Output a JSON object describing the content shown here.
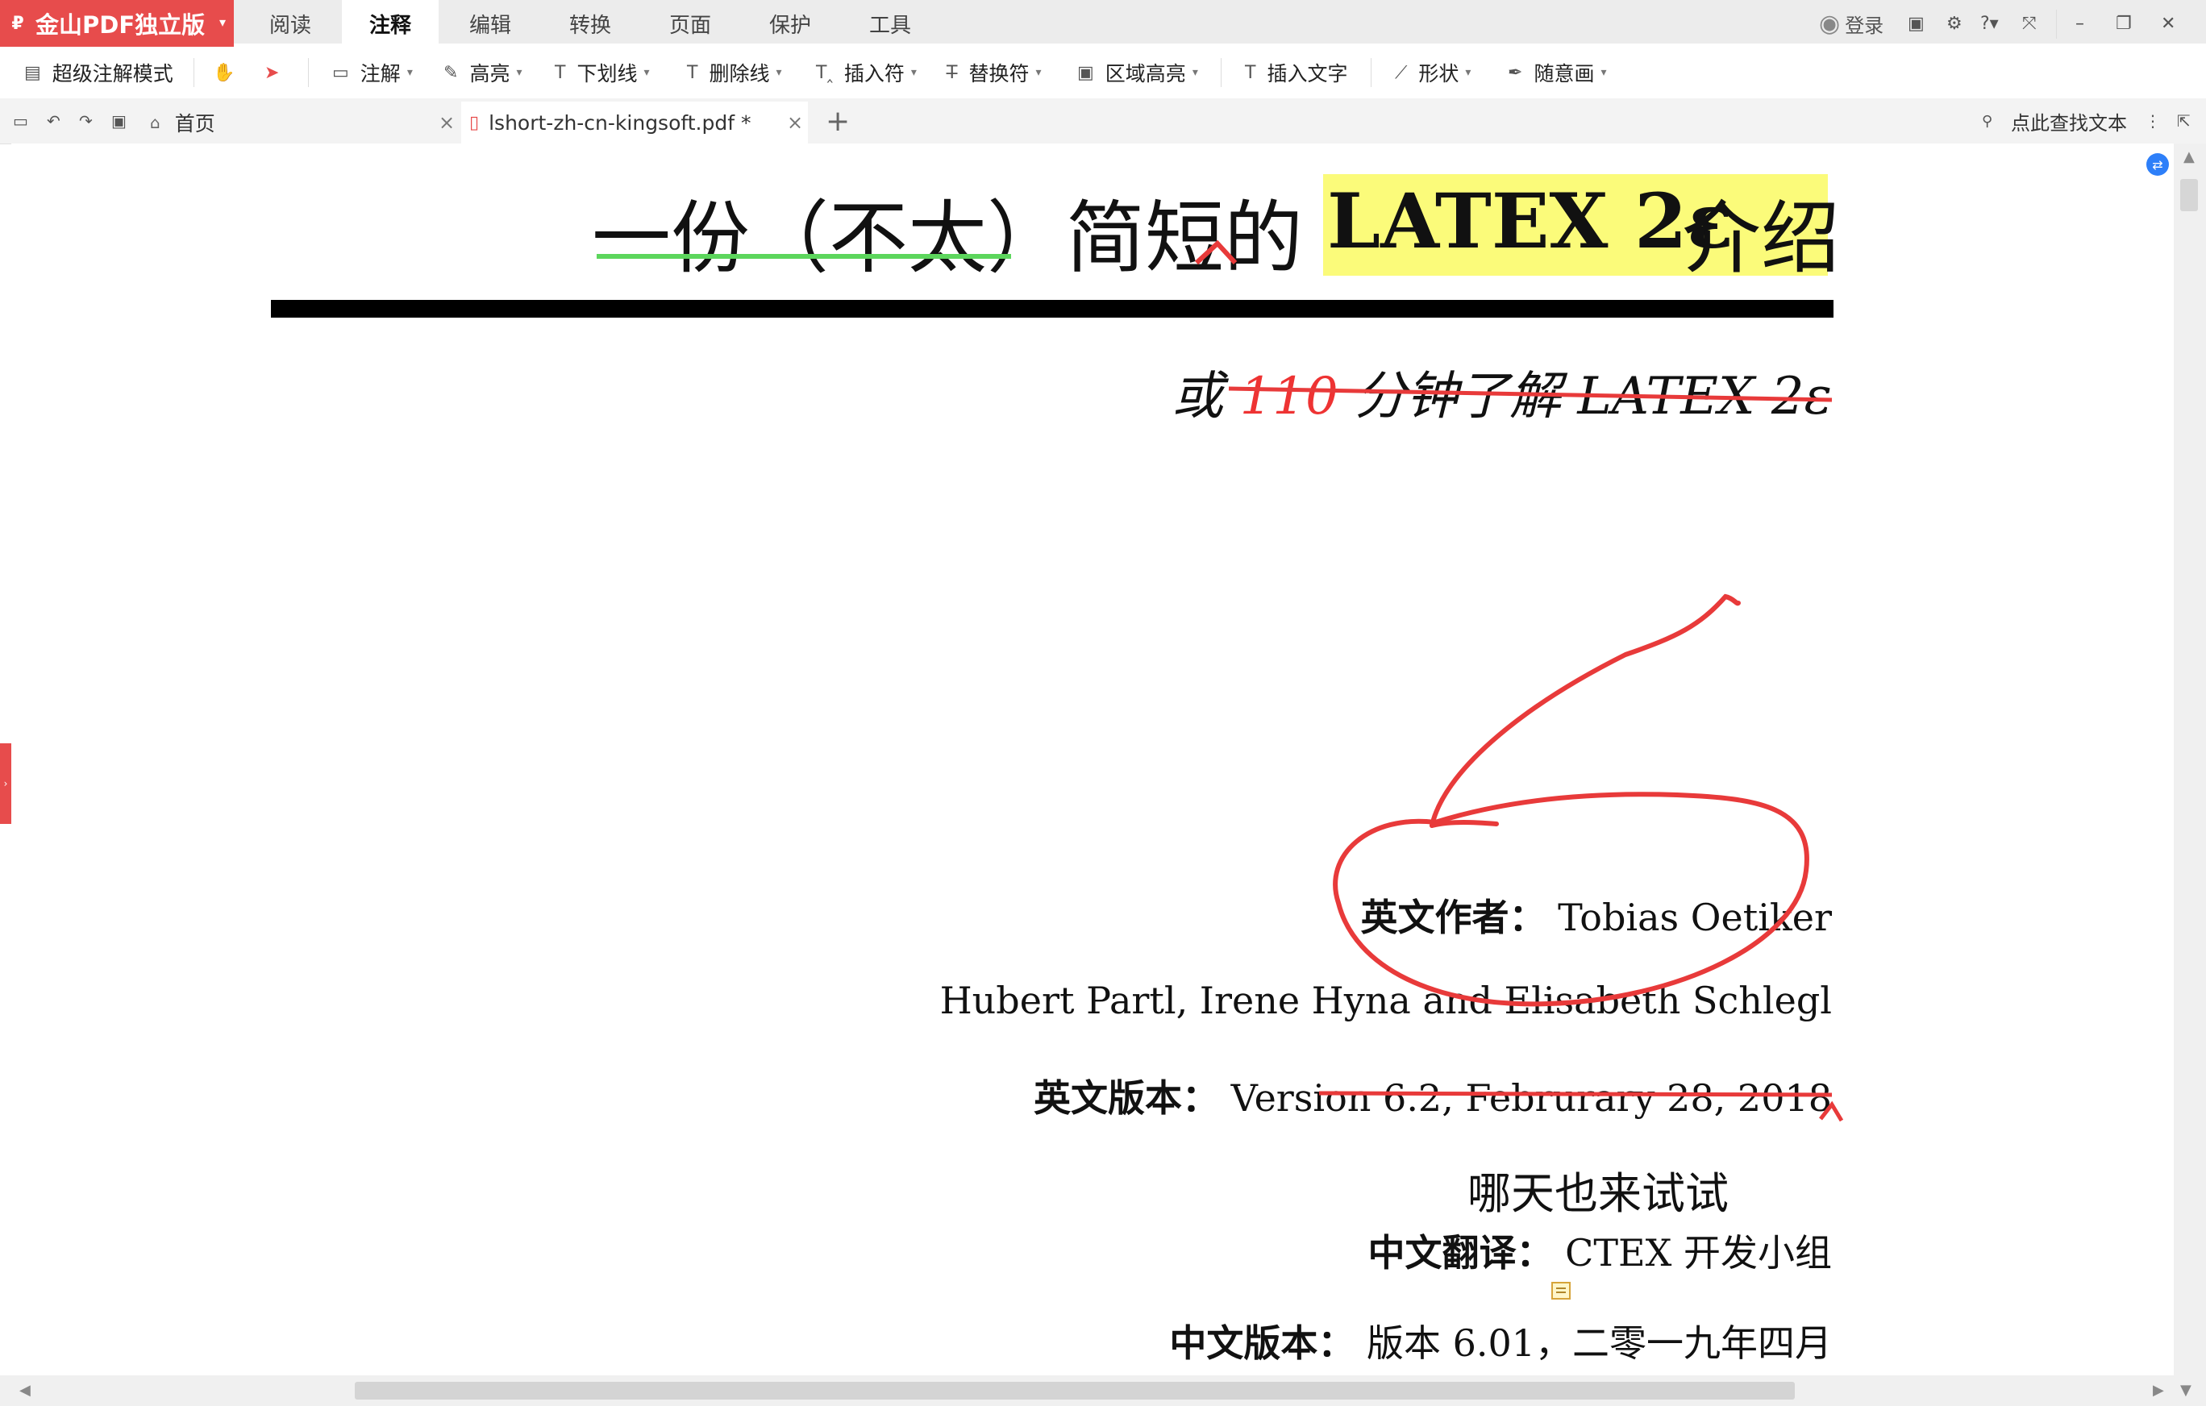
{
  "app": {
    "title": "金山PDF独立版"
  },
  "menu_tabs": [
    "阅读",
    "注释",
    "编辑",
    "转换",
    "页面",
    "保护",
    "工具"
  ],
  "login_label": "登录",
  "toolbar": {
    "super_annotate": "超级注解模式",
    "annotate": "注解",
    "highlight": "高亮",
    "underline": "下划线",
    "strikethrough": "删除线",
    "insert_mark": "插入符",
    "replace_mark": "替换符",
    "area_highlight": "区域高亮",
    "insert_text": "插入文字",
    "shape": "形状",
    "freehand": "随意画"
  },
  "doc_tabs": {
    "home": "首页",
    "file": "lshort-zh-cn-kingsoft.pdf *"
  },
  "search_label": "点此查找文本",
  "document": {
    "title_cn": "一份（不太）简短的",
    "title_latex": "LATEX 2ε",
    "title_tail": "介绍",
    "subtitle_prefix": "或",
    "subtitle_number": "110",
    "subtitle_suffix": "分钟了解 LATEX 2ε",
    "author_label": "英文作者：",
    "author_name": "Tobias Oetiker",
    "coauthors": "Hubert Partl, Irene Hyna and Elisabeth Schlegl",
    "version_label": "英文版本：",
    "version_value": "Version 6.2, Februrary 28, 2018",
    "inserted_text": "哪天也来试试",
    "translation_label": "中文翻译：",
    "translation_value": "CTEX 开发小组",
    "cn_version_label": "中文版本：",
    "cn_version_value": "版本 6.01，二零一九年四月"
  },
  "colors": {
    "brand": "#e74c4c",
    "annotation_red": "#e83a3a",
    "highlight_yellow": "#fbfb7a",
    "underline_green": "#5cd65c"
  }
}
